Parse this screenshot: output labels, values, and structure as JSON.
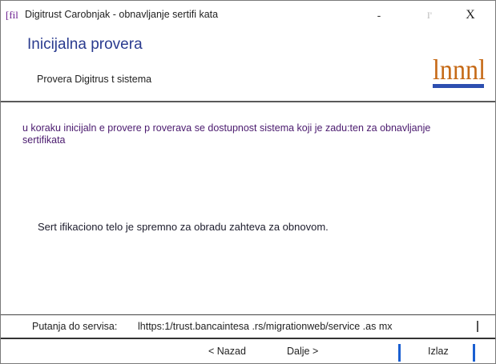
{
  "window": {
    "icon_text": "[fil",
    "title": "Digitrust Carobnjak - obnavljanje sertifi kata",
    "minimize_label": "-",
    "maximize_label": "I'",
    "close_label": "X"
  },
  "header": {
    "title": "Inicijalna provera",
    "subtitle": "Provera Digitrus t sistema",
    "logo_text": "lnnnl",
    "logo_color": "#c66a17",
    "logo_underline_color": "#2d4fb0"
  },
  "content": {
    "intro": "u koraku inicijaln e provere p roverava se dostupnost sistema koji je zadu:ten za obnavljanje sertifikata",
    "status": "Sert ifikaciono telo je spremno za obradu zahteva za obnovom."
  },
  "service": {
    "label": "Putanja  do servisa:",
    "url": "lhttps:1/trust.bancaintesa .rs/migrationweb/service .as mx"
  },
  "footer": {
    "back_label": "< Nazad",
    "next_label": "Dalje >",
    "exit_label": "Izlaz"
  },
  "colors": {
    "accent_blue": "#1a5fd1",
    "title_blue": "#2a3b8f",
    "intro_purple": "#4a1a6e"
  }
}
